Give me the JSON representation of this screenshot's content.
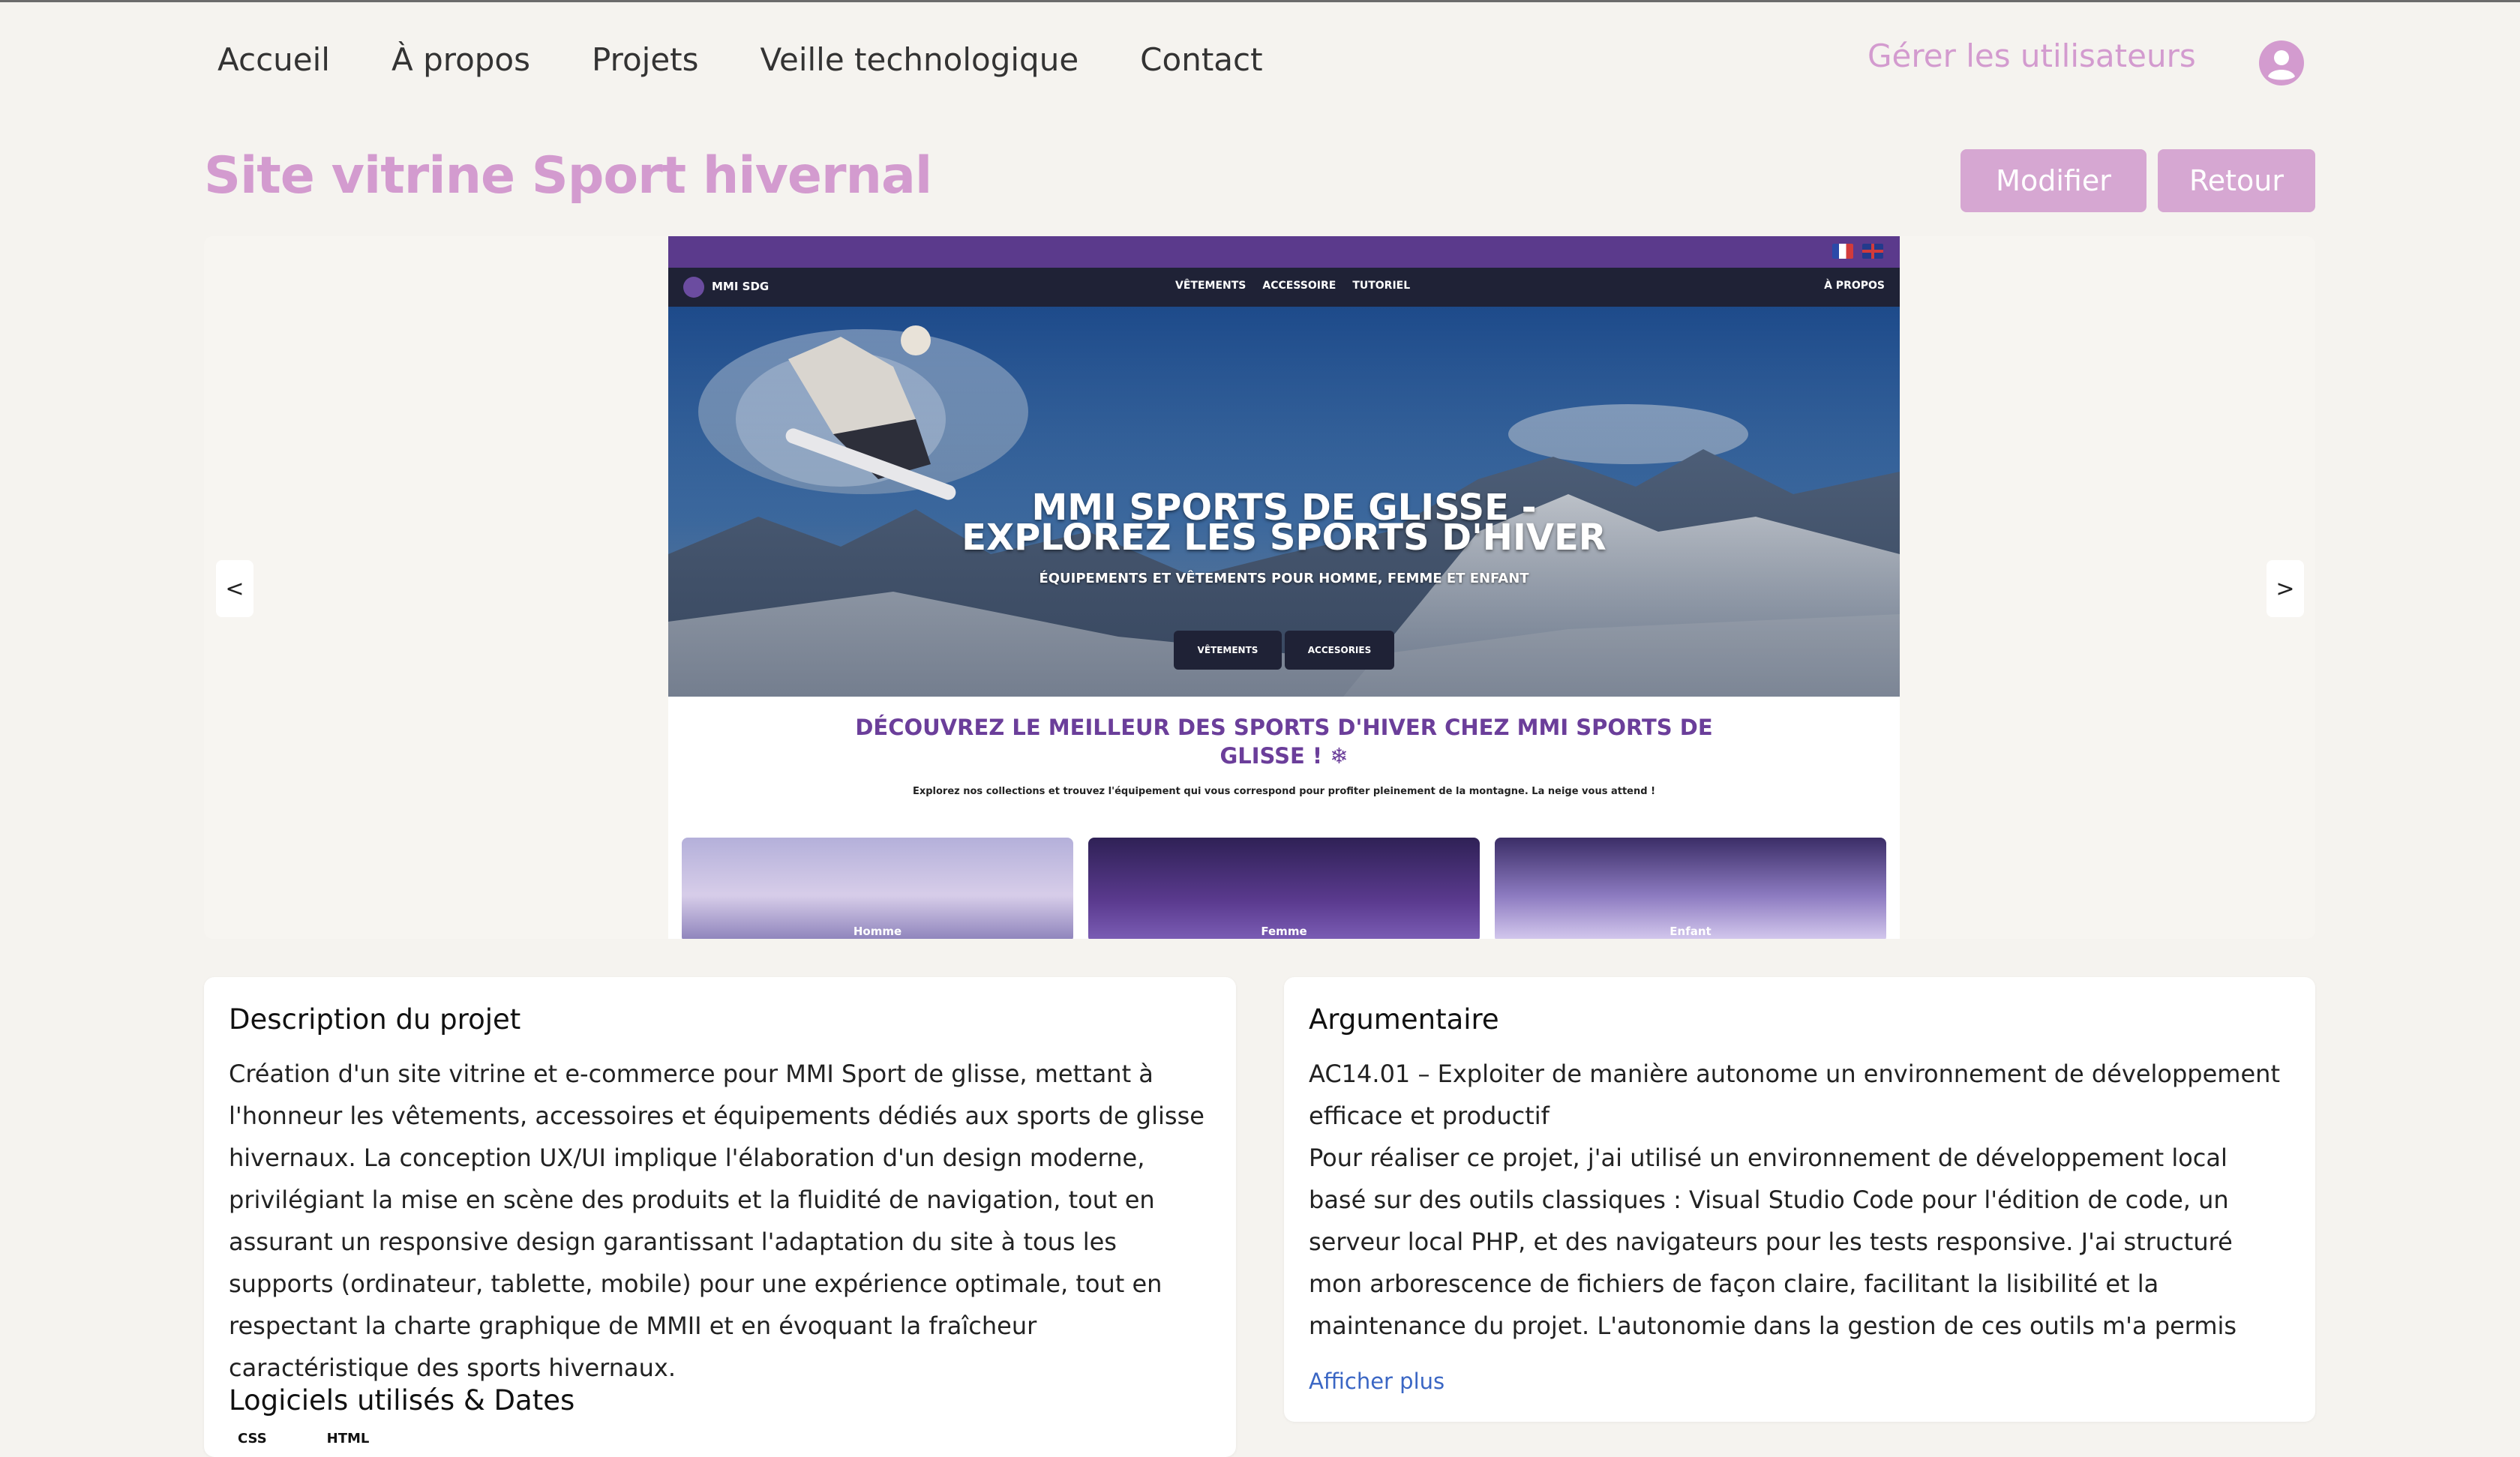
{
  "nav": {
    "items": [
      {
        "label": "Accueil"
      },
      {
        "label": "À propos"
      },
      {
        "label": "Projets"
      },
      {
        "label": "Veille technologique"
      },
      {
        "label": "Contact"
      }
    ],
    "manage_users": "Gérer les utilisateurs",
    "account_icon": "user-circle-icon"
  },
  "page": {
    "title": "Site vitrine Sport hivernal",
    "modify_label": "Modifier",
    "back_label": "Retour"
  },
  "carousel": {
    "prev_label": "<",
    "next_label": ">",
    "slide": {
      "logo_text": "MMI SDG",
      "nav_links": [
        "VÊTEMENTS",
        "ACCESSOIRE",
        "TUTORIEL"
      ],
      "about_label": "À PROPOS",
      "hero_title_1": "MMI SPORTS DE GLISSE -",
      "hero_title_2": "EXPLOREZ LES SPORTS D'HIVER",
      "hero_subtitle": "ÉQUIPEMENTS ET VÊTEMENTS POUR HOMME, FEMME ET ENFANT",
      "hero_button_1": "VÊTEMENTS",
      "hero_button_2": "ACCESORIES",
      "section_title": "DÉCOUVREZ LE MEILLEUR DES SPORTS D'HIVER CHEZ MMI SPORTS DE GLISSE ! ❄",
      "section_text": "Explorez nos collections et trouvez l'équipement qui vous correspond pour profiter pleinement de la montagne. La neige vous attend !",
      "categories": [
        "Homme",
        "Femme",
        "Enfant"
      ]
    }
  },
  "description": {
    "title": "Description du projet",
    "text": "Création d'un site vitrine et e-commerce pour MMI Sport de glisse, mettant à l'honneur les vêtements, accessoires et équipements dédiés aux sports de glisse hivernaux. La conception UX/UI implique l'élaboration d'un design moderne, privilégiant la mise en scène des produits et la fluidité de navigation, tout en assurant un responsive design garantissant l'adaptation du site à tous les supports (ordinateur, tablette, mobile) pour une expérience optimale, tout en respectant la charte graphique de MMII et en évoquant la fraîcheur caractéristique des sports hivernaux.",
    "software_title": "Logiciels utilisés & Dates",
    "software": [
      "CSS",
      "HTML"
    ]
  },
  "argument": {
    "title": "Argumentaire",
    "text_1": "AC14.01 – Exploiter de manière autonome un environnement de développement efficace et productif",
    "text_2": "Pour réaliser ce projet, j'ai utilisé un environnement de développement local basé sur des outils classiques : Visual Studio Code pour l'édition de code, un serveur local PHP, et des navigateurs pour les tests responsive. J'ai structuré mon arborescence de fichiers de façon claire, facilitant la lisibilité et la maintenance du projet. L'autonomie dans la gestion de ces outils m'a permis d'avancer efficacement, sans dépendre d'un CMS ou",
    "more_label": "Afficher plus"
  },
  "colors": {
    "accent": "#d39bcf",
    "button": "#d6a7d2",
    "background": "#f5f3ef",
    "link": "#3a66c4"
  }
}
